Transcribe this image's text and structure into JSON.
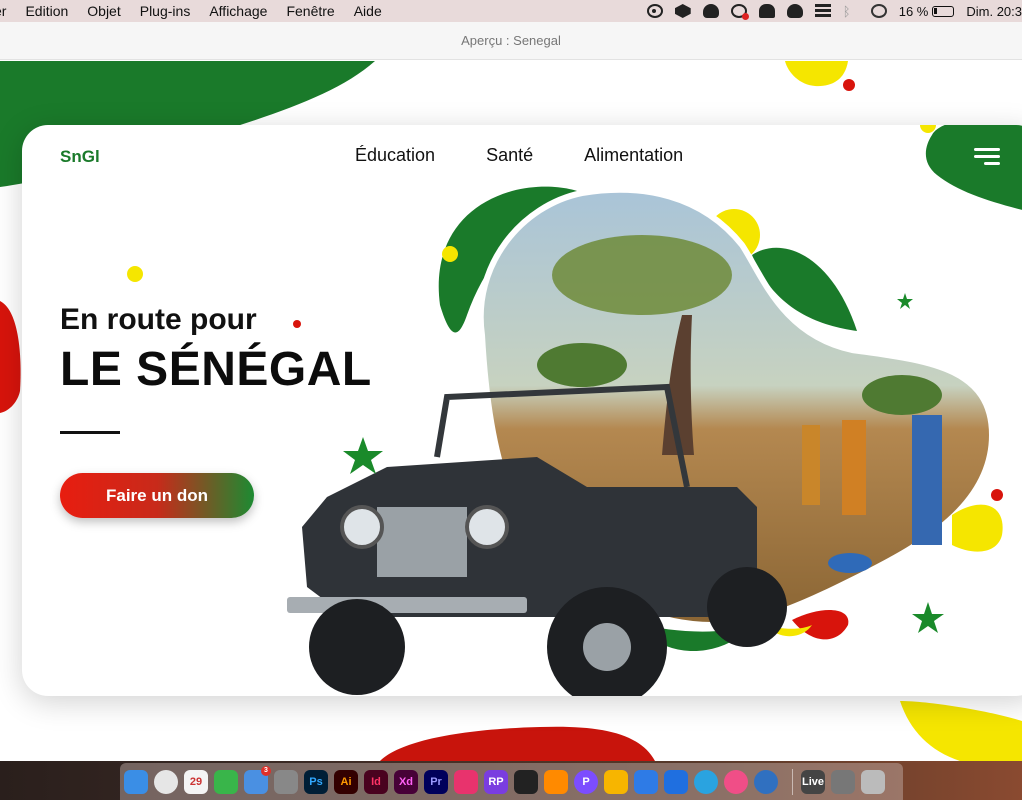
{
  "menubar": {
    "menus": [
      "er",
      "Edition",
      "Objet",
      "Plug-ins",
      "Affichage",
      "Fenêtre",
      "Aide"
    ],
    "battery": "16 %",
    "clock": "Dim. 20:3"
  },
  "window": {
    "title": "Aperçu : Senegal"
  },
  "site": {
    "logo": "SnGl",
    "nav": [
      "Éducation",
      "Santé",
      "Alimentation"
    ],
    "kicker": "En route pour",
    "headline": "LE SÉNÉGAL",
    "cta": "Faire un don"
  },
  "colors": {
    "green": "#1a7a2a",
    "yellow": "#f5e600",
    "red": "#d8140c"
  },
  "dock": {
    "items": [
      {
        "icon": "finder-icon",
        "label": ""
      },
      {
        "icon": "chrome-icon",
        "label": ""
      },
      {
        "icon": "calendar-icon",
        "label": "29"
      },
      {
        "icon": "facetime-icon",
        "label": ""
      },
      {
        "icon": "messages-icon",
        "label": "",
        "badge": "3"
      },
      {
        "icon": "system-preferences-icon",
        "label": ""
      },
      {
        "icon": "photoshop-icon",
        "label": "Ps"
      },
      {
        "icon": "illustrator-icon",
        "label": "Ai"
      },
      {
        "icon": "indesign-icon",
        "label": "Id"
      },
      {
        "icon": "xd-icon",
        "label": "Xd"
      },
      {
        "icon": "premiere-icon",
        "label": "Pr"
      },
      {
        "icon": "app-pink-icon",
        "label": ""
      },
      {
        "icon": "rp-icon",
        "label": "RP"
      },
      {
        "icon": "figma-icon",
        "label": ""
      },
      {
        "icon": "sublime-icon",
        "label": ""
      },
      {
        "icon": "pockity-icon",
        "label": "P"
      },
      {
        "icon": "sketch-icon",
        "label": ""
      },
      {
        "icon": "app-blue-icon",
        "label": ""
      },
      {
        "icon": "framer-icon",
        "label": ""
      },
      {
        "icon": "telegram-icon",
        "label": ""
      },
      {
        "icon": "itunes-icon",
        "label": ""
      },
      {
        "icon": "quicktime-icon",
        "label": ""
      },
      {
        "icon": "live-icon",
        "label": "Live"
      },
      {
        "icon": "jeep-file-icon",
        "label": ""
      },
      {
        "icon": "trash-icon",
        "label": ""
      }
    ]
  }
}
